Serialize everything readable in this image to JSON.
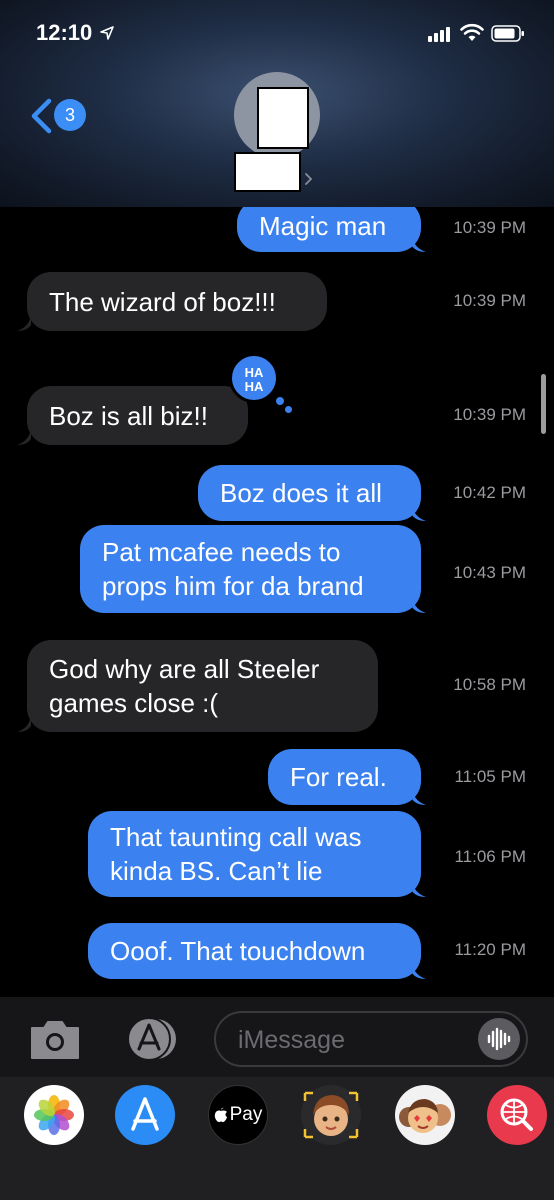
{
  "status_bar": {
    "time": "12:10"
  },
  "header": {
    "back_count": "3"
  },
  "messages": [
    {
      "text": "Magic man",
      "time": "10:39 PM",
      "direction": "outgoing"
    },
    {
      "text": "The wizard of boz!!!",
      "time": "10:39 PM",
      "direction": "incoming"
    },
    {
      "text": "Boz is all biz!!",
      "time": "10:39 PM",
      "direction": "incoming",
      "tapback": "HA HA"
    },
    {
      "text": "Boz does it all",
      "time": "10:42 PM",
      "direction": "outgoing"
    },
    {
      "lines": [
        "Pat mcafee needs to",
        "props him for da brand"
      ],
      "time": "10:43 PM",
      "direction": "outgoing"
    },
    {
      "lines": [
        "God why are all Steeler",
        "games close :("
      ],
      "time": "10:58 PM",
      "direction": "incoming"
    },
    {
      "text": "For real.",
      "time": "11:05 PM",
      "direction": "outgoing"
    },
    {
      "lines": [
        "That taunting call was",
        "kinda BS. Can’t lie"
      ],
      "time": "11:06 PM",
      "direction": "outgoing"
    },
    {
      "text": "Ooof. That touchdown",
      "time": "11:20 PM",
      "direction": "outgoing"
    }
  ],
  "input": {
    "placeholder": "iMessage"
  },
  "app_drawer": {
    "apps": [
      "photos-icon",
      "app-store-icon",
      "apple-pay-icon",
      "memoji-icon",
      "memoji-stickers-icon",
      "web-images-icon"
    ],
    "apple_pay_label": "Pay"
  },
  "colors": {
    "outgoing": "#3b82f0",
    "incoming": "#262629",
    "accent": "#3a8ef6"
  }
}
